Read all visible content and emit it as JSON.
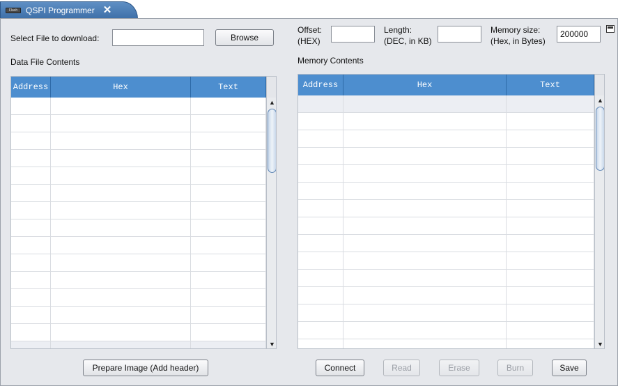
{
  "tab": {
    "title": "QSPI Programmer",
    "icon_text": "Flash"
  },
  "left": {
    "select_file_label": "Select File to download:",
    "file_value": "",
    "browse_label": "Browse",
    "section_title": "Data File Contents",
    "columns": [
      "Address",
      "Hex",
      "Text"
    ],
    "prepare_label": "Prepare Image (Add header)"
  },
  "right": {
    "offset_label_1": "Offset:",
    "offset_label_2": "(HEX)",
    "offset_value": "",
    "length_label_1": "Length:",
    "length_label_2": "(DEC, in KB)",
    "length_value": "",
    "memsize_label_1": "Memory size:",
    "memsize_label_2": "(Hex, in Bytes)",
    "memsize_value": "200000",
    "section_title": "Memory Contents",
    "columns": [
      "Address",
      "Hex",
      "Text"
    ]
  },
  "actions": {
    "connect": "Connect",
    "read": "Read",
    "erase": "Erase",
    "burn": "Burn",
    "save": "Save"
  },
  "icons": {
    "close": "close-icon",
    "maximize": "maximize-icon",
    "scroll_up": "scroll-up-arrow-icon",
    "scroll_down": "scroll-down-arrow-icon"
  }
}
